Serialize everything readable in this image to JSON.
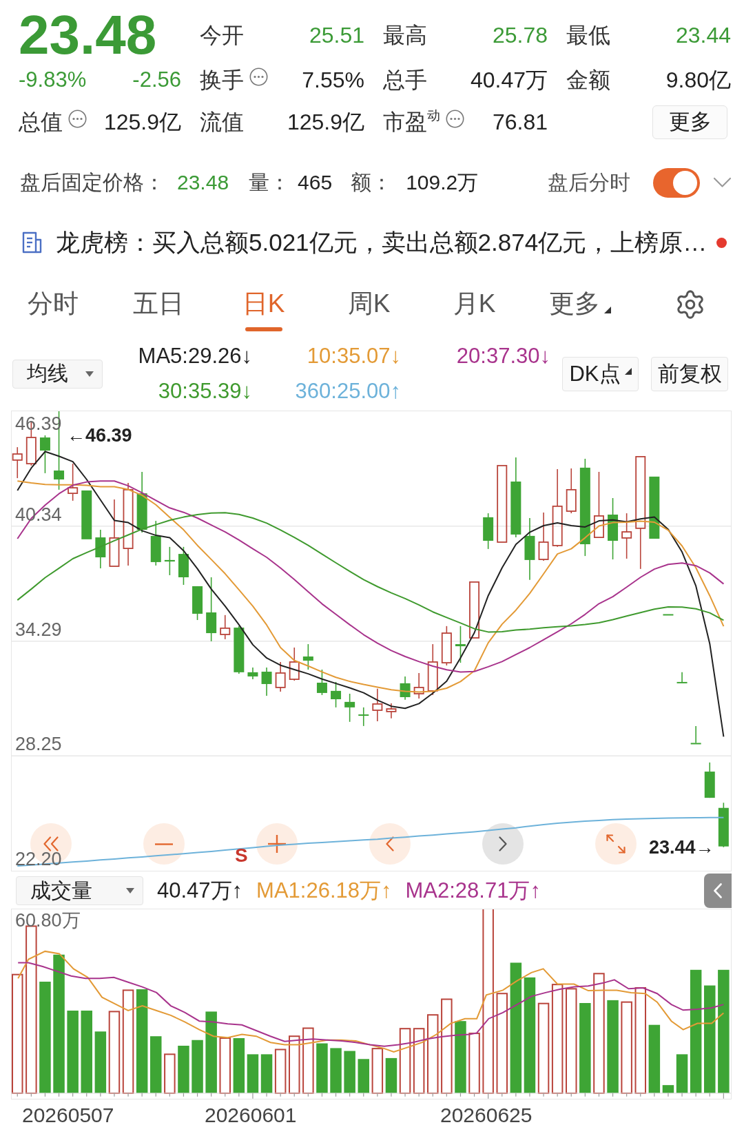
{
  "quote": {
    "price": "23.48",
    "change_percent": "-9.83%",
    "change": "-2.56",
    "falling": true
  },
  "stats": [
    {
      "label": "今开",
      "value": "25.51",
      "color": "#3b9a36",
      "info": false
    },
    {
      "label": "最高",
      "value": "25.78",
      "color": "#3b9a36",
      "info": false
    },
    {
      "label": "最低",
      "value": "23.44",
      "color": "#3b9a36",
      "info": false
    },
    {
      "label": "换手",
      "value": "7.55%",
      "color": "#222222",
      "info": true
    },
    {
      "label": "总手",
      "value": "40.47万",
      "color": "#222222",
      "info": false
    },
    {
      "label": "金额",
      "value": "9.80亿",
      "color": "#222222",
      "info": false
    },
    {
      "label": "总值",
      "value": "125.9亿",
      "color": "#222222",
      "info": true
    },
    {
      "label": "流值",
      "value": "125.9亿",
      "color": "#222222",
      "info": false
    },
    {
      "label": "市盈$^{动}$",
      "value": "76.81",
      "color": "#222222",
      "info": true
    }
  ],
  "more_button": "更多",
  "after_hours": {
    "label": "盘后固定价格：",
    "price": "23.48",
    "falling": true,
    "items": [
      {
        "label": "量：",
        "value": "465"
      },
      {
        "label": "额：",
        "value": "109.2万"
      }
    ],
    "toggle_label": "盘后分时",
    "toggle_on": true
  },
  "notice": {
    "text": "龙虎榜：买入总额5.021亿元，卖出总额2.874亿元，上榜原…",
    "unread": true
  },
  "period_tabs": [
    {
      "label": "分时",
      "selected": false,
      "kind": "tab"
    },
    {
      "label": "五日",
      "selected": false,
      "kind": "tab"
    },
    {
      "label": "日K",
      "selected": true,
      "kind": "tab"
    },
    {
      "label": "周K",
      "selected": false,
      "kind": "tab"
    },
    {
      "label": "月K",
      "selected": false,
      "kind": "tab"
    },
    {
      "label": "更多",
      "selected": false,
      "kind": "menu"
    }
  ],
  "indicator_select": "均线",
  "ma_readings": [
    {
      "text": "MA5:29.26↓",
      "color": "#222222"
    },
    {
      "text": "10:35.07↓",
      "color": "#e39a36"
    },
    {
      "text": "20:37.30↓",
      "color": "#a8338c"
    },
    {
      "text": "30:35.39↓",
      "color": "#3f9a2e"
    },
    {
      "text": "360:25.00↑",
      "color": "#6db2da"
    }
  ],
  "chart_options": [
    {
      "label": "DK点",
      "kind": "menu"
    },
    {
      "label": "前复权",
      "kind": "button"
    }
  ],
  "price_chart": {
    "top_label": "46.39",
    "chart_data": {
      "type": "candlestick",
      "grid": true,
      "ylim": [
        22.2,
        46.39
      ],
      "yticks": [
        {
          "value": 40.34,
          "label": "40.34"
        },
        {
          "value": 34.29,
          "label": "34.29"
        },
        {
          "value": 28.25,
          "label": "28.25"
        },
        {
          "value": 22.2,
          "label": "22.20"
        }
      ],
      "ohlc": [
        [
          43.82,
          44.5,
          42.87,
          44.14
        ],
        [
          43.63,
          45.81,
          43.53,
          45.01
        ],
        [
          45.01,
          45.12,
          43.13,
          44.32
        ],
        [
          43.27,
          46.39,
          42.26,
          42.8
        ],
        [
          42.07,
          43.63,
          41.68,
          42.36
        ],
        [
          42.22,
          42.22,
          39.65,
          39.65
        ],
        [
          39.75,
          40.15,
          38.12,
          38.7
        ],
        [
          38.23,
          41.75,
          38.23,
          39.72
        ],
        [
          39.17,
          42.62,
          38.27,
          42.26
        ],
        [
          42.07,
          43.2,
          40.01,
          40.15
        ],
        [
          39.83,
          40.62,
          38.27,
          38.45
        ],
        [
          38.56,
          39.25,
          37.76,
          38.48
        ],
        [
          38.88,
          39.25,
          37.25,
          37.65
        ],
        [
          37.18,
          37.18,
          35.4,
          35.73
        ],
        [
          35.8,
          37.65,
          34.28,
          34.71
        ],
        [
          34.64,
          35.66,
          34.39,
          34.97
        ],
        [
          35.0,
          35.08,
          32.57,
          32.65
        ],
        [
          32.65,
          32.9,
          32.28,
          32.43
        ],
        [
          32.68,
          32.9,
          31.41,
          32.03
        ],
        [
          31.85,
          33.19,
          31.63,
          32.61
        ],
        [
          32.28,
          33.95,
          32.21,
          33.19
        ],
        [
          33.48,
          34.13,
          32.79,
          33.26
        ],
        [
          32.1,
          32.79,
          31.45,
          31.56
        ],
        [
          31.67,
          32.14,
          30.8,
          31.23
        ],
        [
          31.09,
          31.52,
          30.04,
          30.8
        ],
        [
          30.43,
          30.8,
          29.82,
          30.36
        ],
        [
          30.65,
          31.78,
          30.07,
          30.98
        ],
        [
          30.58,
          31.01,
          30.22,
          30.72
        ],
        [
          32.07,
          32.43,
          31.2,
          31.34
        ],
        [
          31.52,
          32.61,
          31.27,
          31.85
        ],
        [
          31.67,
          34.13,
          31.45,
          33.19
        ],
        [
          33.15,
          35.08,
          33.01,
          34.71
        ],
        [
          34.13,
          35.08,
          33.15,
          34.02
        ],
        [
          34.46,
          37.4,
          34.46,
          37.4
        ],
        [
          40.81,
          41.02,
          39.14,
          39.57
        ],
        [
          39.5,
          43.53,
          39.5,
          43.53
        ],
        [
          42.69,
          43.96,
          39.75,
          39.9
        ],
        [
          39.83,
          40.77,
          37.51,
          38.56
        ],
        [
          38.59,
          41.06,
          38.52,
          39.5
        ],
        [
          39.32,
          43.34,
          39.25,
          41.39
        ],
        [
          41.13,
          43.38,
          41.02,
          42.26
        ],
        [
          43.42,
          43.89,
          38.77,
          39.39
        ],
        [
          39.75,
          43.2,
          39.75,
          40.88
        ],
        [
          40.95,
          41.82,
          38.59,
          39.57
        ],
        [
          39.72,
          41.02,
          38.63,
          40.04
        ],
        [
          40.23,
          44.0,
          38.09,
          44.0
        ],
        [
          42.95,
          42.95,
          39.68,
          39.68
        ],
        [
          35.71,
          35.71,
          35.71,
          35.71
        ],
        [
          32.14,
          32.65,
          32.14,
          32.14
        ],
        [
          28.93,
          29.82,
          28.93,
          28.93
        ],
        [
          27.42,
          27.9,
          26.04,
          26.04
        ],
        [
          25.51,
          25.78,
          23.44,
          23.48
        ]
      ]
    },
    "moving_averages": {
      "chart_data": {
        "type": "line",
        "ylim": [
          22.2,
          46.39
        ],
        "series": [
          {
            "color": "#222222",
            "values": [
              42.22,
              43.4,
              44.27,
              44.02,
              43.74,
              42.8,
              41.72,
              40.64,
              40.53,
              40.1,
              39.86,
              39.74,
              39.05,
              38.1,
              37.03,
              36.13,
              35.15,
              34.1,
              33.4,
              33.02,
              32.79,
              32.57,
              32.29,
              32.06,
              31.83,
              31.57,
              31.18,
              30.86,
              30.75,
              31.0,
              31.55,
              32.18,
              33.41,
              34.73,
              36.68,
              38.15,
              39.38,
              40.02,
              40.37,
              40.52,
              40.37,
              40.3,
              40.62,
              40.67,
              40.57,
              40.72,
              40.82,
              40.17,
              38.98,
              37.19,
              34.15,
              29.26
            ]
          },
          {
            "color": "#e39a36",
            "values": [
              42.72,
              42.62,
              42.54,
              42.52,
              42.52,
              42.49,
              42.42,
              42.42,
              42.27,
              41.97,
              41.47,
              40.81,
              40.15,
              39.33,
              38.59,
              37.84,
              36.99,
              36.13,
              35.14,
              33.95,
              33.27,
              32.98,
              32.67,
              32.38,
              32.17,
              32.01,
              31.87,
              31.73,
              31.65,
              31.61,
              31.65,
              31.81,
              32.16,
              32.73,
              34.2,
              35.18,
              35.92,
              36.8,
              37.83,
              38.88,
              39.15,
              39.73,
              40.35,
              40.53,
              40.55,
              40.6,
              40.55,
              40.13,
              39.3,
              38.15,
              36.68,
              35.07
            ]
          },
          {
            "color": "#a8338c",
            "values": [
              39.68,
              40.75,
              41.45,
              42.05,
              42.5,
              42.67,
              42.72,
              42.72,
              42.47,
              42.1,
              41.7,
              41.3,
              41.07,
              40.77,
              40.4,
              40.04,
              39.61,
              39.15,
              38.7,
              38.14,
              37.53,
              36.89,
              36.25,
              35.7,
              35.15,
              34.63,
              34.18,
              33.79,
              33.48,
              33.21,
              32.97,
              32.78,
              32.66,
              32.69,
              32.94,
              33.21,
              33.58,
              33.95,
              34.36,
              34.78,
              35.2,
              35.7,
              36.26,
              36.63,
              37.13,
              37.65,
              38.08,
              38.33,
              38.4,
              38.26,
              37.88,
              37.3
            ]
          },
          {
            "color": "#3f9a2e",
            "values": [
              36.45,
              37.03,
              37.63,
              38.13,
              38.63,
              38.95,
              39.26,
              39.58,
              39.88,
              40.18,
              40.42,
              40.65,
              40.82,
              40.95,
              41.03,
              41.05,
              40.96,
              40.77,
              40.5,
              40.14,
              39.75,
              39.33,
              38.87,
              38.41,
              37.96,
              37.53,
              37.16,
              36.83,
              36.53,
              36.19,
              35.83,
              35.53,
              35.24,
              34.94,
              34.77,
              34.79,
              34.87,
              34.92,
              34.99,
              35.05,
              35.09,
              35.16,
              35.26,
              35.42,
              35.61,
              35.79,
              35.97,
              36.09,
              36.08,
              35.99,
              35.78,
              35.39
            ]
          },
          {
            "color": "#6db2da",
            "values": [
              22.45,
              22.5,
              22.55,
              22.61,
              22.66,
              22.71,
              22.77,
              22.82,
              22.88,
              22.93,
              22.99,
              23.04,
              23.1,
              23.16,
              23.22,
              23.29,
              23.35,
              23.42,
              23.49,
              23.55,
              23.6,
              23.65,
              23.69,
              23.73,
              23.78,
              23.82,
              23.86,
              23.92,
              23.97,
              24.03,
              24.08,
              24.14,
              24.19,
              24.25,
              24.32,
              24.39,
              24.46,
              24.55,
              24.63,
              24.7,
              24.76,
              24.81,
              24.85,
              24.89,
              24.92,
              24.94,
              24.96,
              24.97,
              24.98,
              24.99,
              25.0,
              25.0
            ]
          }
        ]
      }
    },
    "high_marker": "←46.39",
    "low_marker": "23.44→",
    "signal": "S"
  },
  "chart_controls": [
    {
      "kind": "first",
      "disabled": false
    },
    {
      "kind": "zoom_out",
      "disabled": false
    },
    {
      "kind": "zoom_in",
      "disabled": false
    },
    {
      "kind": "prev",
      "disabled": false
    },
    {
      "kind": "next",
      "disabled": true
    },
    {
      "kind": "fullscreen",
      "disabled": false
    }
  ],
  "volume_panel": {
    "select": "成交量",
    "readings": [
      {
        "text": "40.47万↑",
        "color": "#222222"
      },
      {
        "text": "MA1:26.18万↑",
        "color": "#e39a36"
      },
      {
        "text": "MA2:28.71万↑",
        "color": "#a8338c"
      }
    ],
    "y_label": "60.80万",
    "dates": [
      "20260507",
      "20260601",
      "20260625"
    ]
  }
}
